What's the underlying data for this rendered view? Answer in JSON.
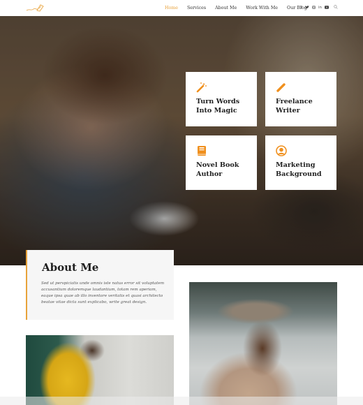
{
  "header": {
    "logo_icon": "quill-pen-logo-icon",
    "nav": [
      {
        "label": "Home",
        "active": true
      },
      {
        "label": "Services",
        "active": false
      },
      {
        "label": "About Me",
        "active": false
      },
      {
        "label": "Work With Me",
        "active": false
      },
      {
        "label": "Our Blog",
        "active": false
      }
    ],
    "social": [
      {
        "icon": "facebook-icon",
        "glyph": "f"
      },
      {
        "icon": "twitter-icon",
        "glyph": "🐦"
      },
      {
        "icon": "instagram-icon",
        "glyph": "◎"
      },
      {
        "icon": "linkedin-icon",
        "glyph": "in"
      },
      {
        "icon": "youtube-icon",
        "glyph": "▣"
      }
    ],
    "search_icon": "search-icon"
  },
  "hero": {
    "cards": [
      {
        "icon": "magic-wand-icon",
        "line1": "Turn Words",
        "line2": "Into Magic"
      },
      {
        "icon": "pencil-icon",
        "line1": "Freelance",
        "line2": "Writer"
      },
      {
        "icon": "book-icon",
        "line1": "Novel Book",
        "line2": "Author"
      },
      {
        "icon": "user-circle-icon",
        "line1": "Marketing",
        "line2": "Background"
      }
    ]
  },
  "about": {
    "title": "About Me",
    "text": "Sed ut perspiciatis unde omnis iste natus error sit voluptatem accusantium doloremque laudantium, totam rem aperiam, eaque ipsa quae ab illo inventore veritatis et quasi architecto beatae vitae dicta sunt explicabo, write great design."
  },
  "colors": {
    "accent": "#e8a23a",
    "text_dark": "#222222",
    "about_bg": "#f6f6f6"
  }
}
